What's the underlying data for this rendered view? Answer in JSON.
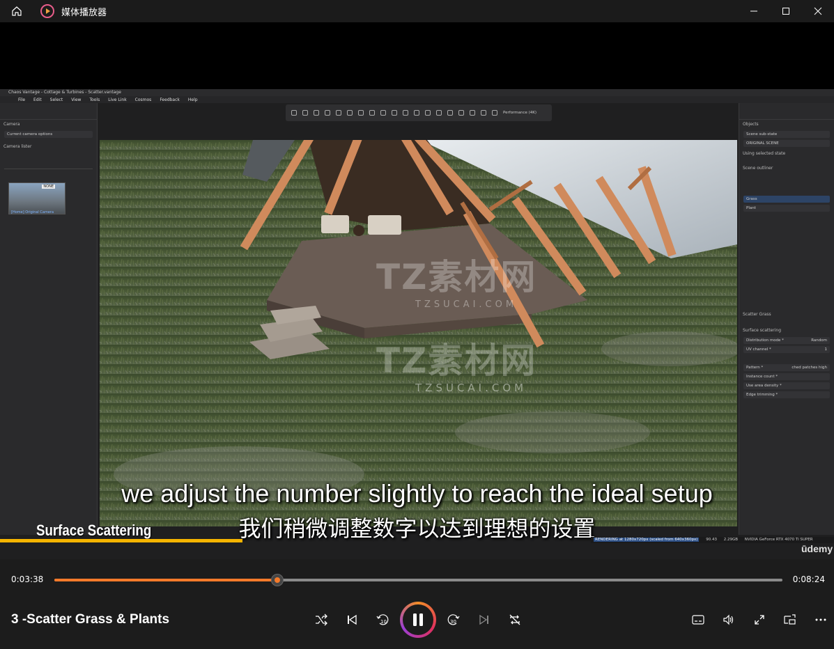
{
  "window": {
    "title": "媒体播放器"
  },
  "video": {
    "app_title": "Chaos Vantage - Cottage & Turbines - Scatter.vantage",
    "menu": [
      "File",
      "Edit",
      "Select",
      "View",
      "Tools",
      "Live Link",
      "Cosmos",
      "Feedback",
      "Help"
    ],
    "left_panel": {
      "section": "Camera",
      "current_camera_options": "Current camera options",
      "camera_list": "Camera lister",
      "camera_badge": "NONE",
      "camera_name": "[Home] Original Camera"
    },
    "toolbar": {
      "performance": "Performance (4K)"
    },
    "right_panel": {
      "section": "Objects",
      "scene_substate": "Scene sub-state",
      "original_scene": "ORIGINAL SCENE",
      "using_selected_state": "Using selected state",
      "scene_outliner": "Scene outliner",
      "outliner_items": [
        "Grass",
        "Plant"
      ],
      "scatter_title": "Scatter Grass",
      "surface_scattering": "Surface scattering",
      "distribution_mode_label": "Distribution mode *",
      "distribution_mode_value": "Random",
      "uv_channel_label": "UV channel *",
      "uv_channel_value": "1",
      "pattern_label": "Pattern *",
      "pattern_value": "ched patches high",
      "instance_count_label": "Instance count *",
      "use_area_density": "Use area density *",
      "edge_trimming": "Edge trimming *"
    },
    "watermark_text": "TZ素材网",
    "watermark_url": "TZSUCAI.COM",
    "subtitle_en": "we adjust the number slightly to reach the ideal setup",
    "subtitle_zh": "我们稍微调整数字以达到理想的设置",
    "section_label": "Surface Scattering",
    "status": {
      "rendering": "RENDERING at 1280x720px (scaled from 640x360px)",
      "fps": "90.43",
      "memory": "2.29GB",
      "gpu": "NVIDIA GeForce RTX 4070 Ti SUPER"
    },
    "brand": "ūdemy"
  },
  "player": {
    "current_time": "0:03:38",
    "total_time": "0:08:24",
    "progress": 0.306,
    "media_title": "3 -Scatter Grass & Plants",
    "accent": "#f47a2a"
  }
}
